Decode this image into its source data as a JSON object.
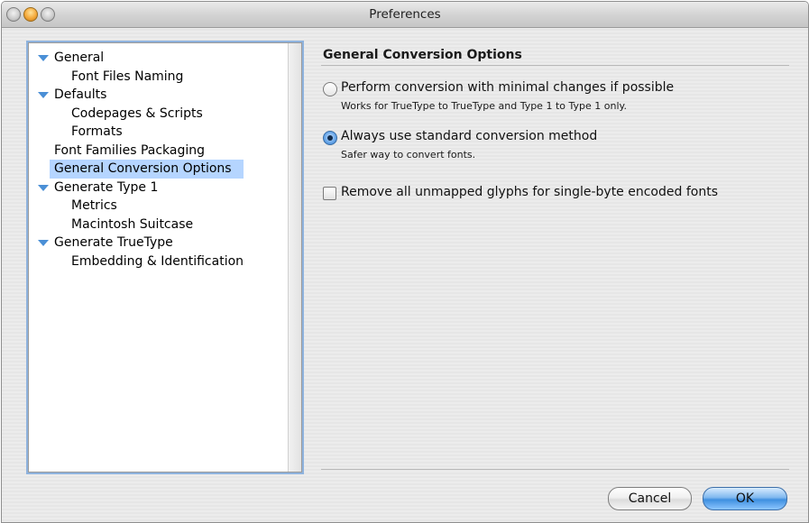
{
  "window": {
    "title": "Preferences"
  },
  "sidebar": {
    "items": [
      {
        "label": "General",
        "level": 0,
        "expanded": true
      },
      {
        "label": "Font Files Naming",
        "level": 1
      },
      {
        "label": "Defaults",
        "level": 0,
        "expanded": true
      },
      {
        "label": "Codepages & Scripts",
        "level": 1
      },
      {
        "label": "Formats",
        "level": 1
      },
      {
        "label": "Font Families Packaging",
        "level": 0
      },
      {
        "label": "General Conversion Options",
        "level": 0,
        "selected": true
      },
      {
        "label": "Generate Type 1",
        "level": 0,
        "expanded": true
      },
      {
        "label": "Metrics",
        "level": 1
      },
      {
        "label": "Macintosh Suitcase",
        "level": 1
      },
      {
        "label": "Generate TrueType",
        "level": 0,
        "expanded": true
      },
      {
        "label": "Embedding & Identification",
        "level": 1
      }
    ]
  },
  "panel": {
    "title": "General Conversion Options",
    "options": [
      {
        "type": "radio",
        "checked": false,
        "label": "Perform conversion with minimal changes if possible",
        "description": "Works for TrueType to TrueType and Type 1 to Type 1 only."
      },
      {
        "type": "radio",
        "checked": true,
        "label": "Always use standard conversion method",
        "description": "Safer way to convert fonts."
      },
      {
        "type": "checkbox",
        "checked": false,
        "label": "Remove all unmapped glyphs for single-byte encoded fonts"
      }
    ]
  },
  "buttons": {
    "cancel": "Cancel",
    "ok": "OK"
  },
  "colors": {
    "selection": "#b5d5ff",
    "accent": "#4a8fd6"
  }
}
